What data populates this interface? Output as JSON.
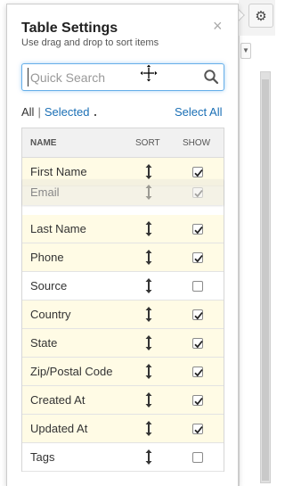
{
  "popover": {
    "title": "Table Settings",
    "subtitle": "Use drag and drop to sort items",
    "close_glyph": "×"
  },
  "search": {
    "placeholder": "Quick Search",
    "value": "",
    "icon": "search-icon"
  },
  "filters": {
    "all_label": "All",
    "separator": "|",
    "selected_label": "Selected",
    "select_all_label": "Select All"
  },
  "table": {
    "headers": {
      "name": "NAME",
      "sort": "SORT",
      "show": "SHOW"
    },
    "rows": [
      {
        "label": "First Name",
        "checked": true
      },
      {
        "label": "Last Name",
        "checked": true
      },
      {
        "label": "Phone",
        "checked": true
      },
      {
        "label": "Source",
        "checked": false
      },
      {
        "label": "Country",
        "checked": true
      },
      {
        "label": "State",
        "checked": true
      },
      {
        "label": "Zip/Postal Code",
        "checked": true
      },
      {
        "label": "Created At",
        "checked": true
      },
      {
        "label": "Updated At",
        "checked": true
      },
      {
        "label": "Tags",
        "checked": false
      }
    ],
    "dragging_row": {
      "label": "Email",
      "checked": true
    }
  },
  "toolbar": {
    "settings_icon": "gear-icon",
    "settings_glyph": "⚙"
  },
  "colors": {
    "link": "#1a6fb5",
    "checked_row_bg": "#fffbe5",
    "focus_border": "#66afe9"
  }
}
